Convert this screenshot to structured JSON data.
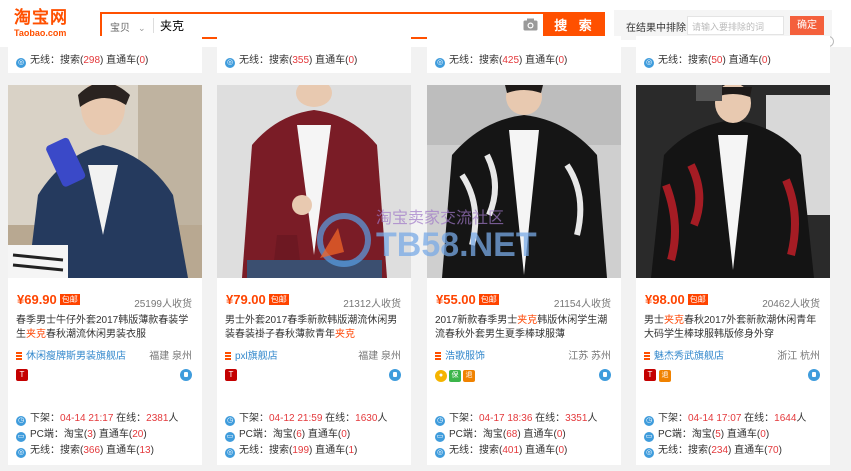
{
  "logo": {
    "cn": "淘宝网",
    "en": "Taobao.com"
  },
  "search": {
    "scope": "宝贝",
    "query": "夹克",
    "button": "搜 索"
  },
  "exclude": {
    "label": "在结果中排除",
    "placeholder": "请输入要排除的词",
    "button": "确定"
  },
  "top_row": [
    {
      "wireless": "无线：搜索(",
      "n1": "298",
      "mid": ") 直通车(",
      "n2": "0",
      "end": ")"
    },
    {
      "wireless": "无线：搜索(",
      "n1": "355",
      "mid": ") 直通车(",
      "n2": "0",
      "end": ")"
    },
    {
      "wireless": "无线：搜索(",
      "n1": "425",
      "mid": ") 直通车(",
      "n2": "0",
      "end": ")"
    },
    {
      "wireless": "无线：搜索(",
      "n1": "50",
      "mid": ") 直通车(",
      "n2": "0",
      "end": ")"
    }
  ],
  "badge": "包邮",
  "products": [
    {
      "price": "¥69.90",
      "sales": "25199人收货",
      "title_pre": "春季男士牛仔外套2017韩版薄款春装学生",
      "title_hl": "夹克",
      "title_post": "春秋潮流休闲男装衣服",
      "shop": "休闲瘦牌斯男装旗舰店",
      "location": "福建 泉州",
      "offline_label": "下架：",
      "offline_time": "04-14 21:17",
      "online_label": "在线：",
      "online_count": "2381",
      "online_unit": "人",
      "pc": "PC端：淘宝(",
      "pc_n1": "3",
      "pc_mid": ") 直通车(",
      "pc_n2": "20",
      "pc_end": ")",
      "wl": "无线：搜索(",
      "wl_n1": "366",
      "wl_mid": ") 直通车(",
      "wl_n2": "13",
      "wl_end": ")"
    },
    {
      "price": "¥79.00",
      "sales": "21312人收货",
      "title_pre": "男士外套2017春季新款韩版潮流休闲男装春装褂子春秋薄款青年",
      "title_hl": "夹克",
      "title_post": "",
      "shop": "pxl旗舰店",
      "location": "福建 泉州",
      "offline_label": "下架：",
      "offline_time": "04-12 21:59",
      "online_label": "在线：",
      "online_count": "1630",
      "online_unit": "人",
      "pc": "PC端：淘宝(",
      "pc_n1": "6",
      "pc_mid": ") 直通车(",
      "pc_n2": "0",
      "pc_end": ")",
      "wl": "无线：搜索(",
      "wl_n1": "199",
      "wl_mid": ") 直通车(",
      "wl_n2": "1",
      "wl_end": ")"
    },
    {
      "price": "¥55.00",
      "sales": "21154人收货",
      "title_pre": "2017新款春季男士",
      "title_hl": "夹克",
      "title_post": "韩版休闲学生潮流春秋外套男生夏季棒球服薄",
      "shop": "浩歌服饰",
      "location": "江苏 苏州",
      "offline_label": "下架：",
      "offline_time": "04-17 18:36",
      "online_label": "在线：",
      "online_count": "3351",
      "online_unit": "人",
      "pc": "PC端：淘宝(",
      "pc_n1": "68",
      "pc_mid": ") 直通车(",
      "pc_n2": "0",
      "pc_end": ")",
      "wl": "无线：搜索(",
      "wl_n1": "401",
      "wl_mid": ") 直通车(",
      "wl_n2": "0",
      "wl_end": ")"
    },
    {
      "price": "¥98.00",
      "sales": "20462人收货",
      "title_pre": "男士",
      "title_hl": "夹克",
      "title_post": "春秋2017外套新款潮休闲青年大码学生棒球服韩版修身外穿",
      "shop": "魅杰秀武旗舰店",
      "location": "浙江 杭州",
      "offline_label": "下架：",
      "offline_time": "04-14 17:07",
      "online_label": "在线：",
      "online_count": "1644",
      "online_unit": "人",
      "pc": "PC端：淘宝(",
      "pc_n1": "5",
      "pc_mid": ") 直通车(",
      "pc_n2": "0",
      "pc_end": ")",
      "wl": "无线：搜索(",
      "wl_n1": "234",
      "wl_mid": ") 直通车(",
      "wl_n2": "70",
      "wl_end": ")"
    }
  ],
  "watermark": {
    "line1": "淘宝卖家交流社区",
    "line2": "TB58.NET"
  },
  "colors": {
    "brand": "#ff5000",
    "price": "#ff4400",
    "link": "#3388cc"
  }
}
